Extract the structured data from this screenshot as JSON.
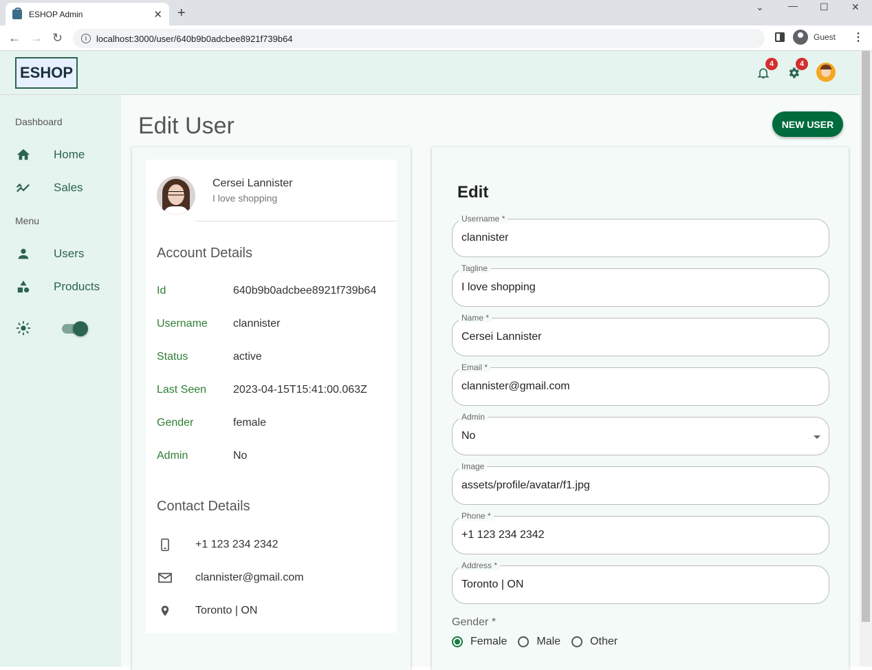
{
  "browser": {
    "tab_title": "ESHOP Admin",
    "url": "localhost:3000/user/640b9b0adcbee8921f739b64",
    "profile_label": "Guest"
  },
  "header": {
    "logo": "ESHOP",
    "notifications_count": "4",
    "settings_count": "4"
  },
  "sidebar": {
    "section_dashboard": "Dashboard",
    "section_menu": "Menu",
    "items": [
      {
        "label": "Home",
        "icon": "home-icon"
      },
      {
        "label": "Sales",
        "icon": "trending-icon"
      },
      {
        "label": "Users",
        "icon": "person-icon"
      },
      {
        "label": "Products",
        "icon": "category-icon"
      }
    ],
    "theme_toggle": "on"
  },
  "page": {
    "title": "Edit User",
    "new_user_button": "NEW USER"
  },
  "profile": {
    "name": "Cersei Lannister",
    "tagline": "I love shopping",
    "account_heading": "Account Details",
    "details": [
      {
        "key": "Id",
        "value": "640b9b0adcbee8921f739b64"
      },
      {
        "key": "Username",
        "value": "clannister"
      },
      {
        "key": "Status",
        "value": "active"
      },
      {
        "key": "Last Seen",
        "value": "2023-04-15T15:41:00.063Z"
      },
      {
        "key": "Gender",
        "value": "female"
      },
      {
        "key": "Admin",
        "value": "No"
      }
    ],
    "contact_heading": "Contact Details",
    "contact": {
      "phone": "+1 123 234 2342",
      "email": "clannister@gmail.com",
      "address": "Toronto | ON"
    }
  },
  "form": {
    "title": "Edit",
    "fields": [
      {
        "label": "Username *",
        "value": "clannister"
      },
      {
        "label": "Tagline",
        "value": "I love shopping"
      },
      {
        "label": "Name *",
        "value": "Cersei Lannister"
      },
      {
        "label": "Email *",
        "value": "clannister@gmail.com"
      },
      {
        "label": "Admin",
        "value": "No"
      },
      {
        "label": "Image",
        "value": "assets/profile/avatar/f1.jpg"
      },
      {
        "label": "Phone *",
        "value": "+1 123 234 2342"
      },
      {
        "label": "Address *",
        "value": "Toronto | ON"
      }
    ],
    "gender_label": "Gender *",
    "gender_options": [
      "Female",
      "Male",
      "Other"
    ],
    "gender_selected": "Female"
  },
  "colors": {
    "accent": "#006b3c",
    "sidebar_bg": "#e6f4ef",
    "label_green": "#2e7d32",
    "badge": "#d32f2f"
  }
}
